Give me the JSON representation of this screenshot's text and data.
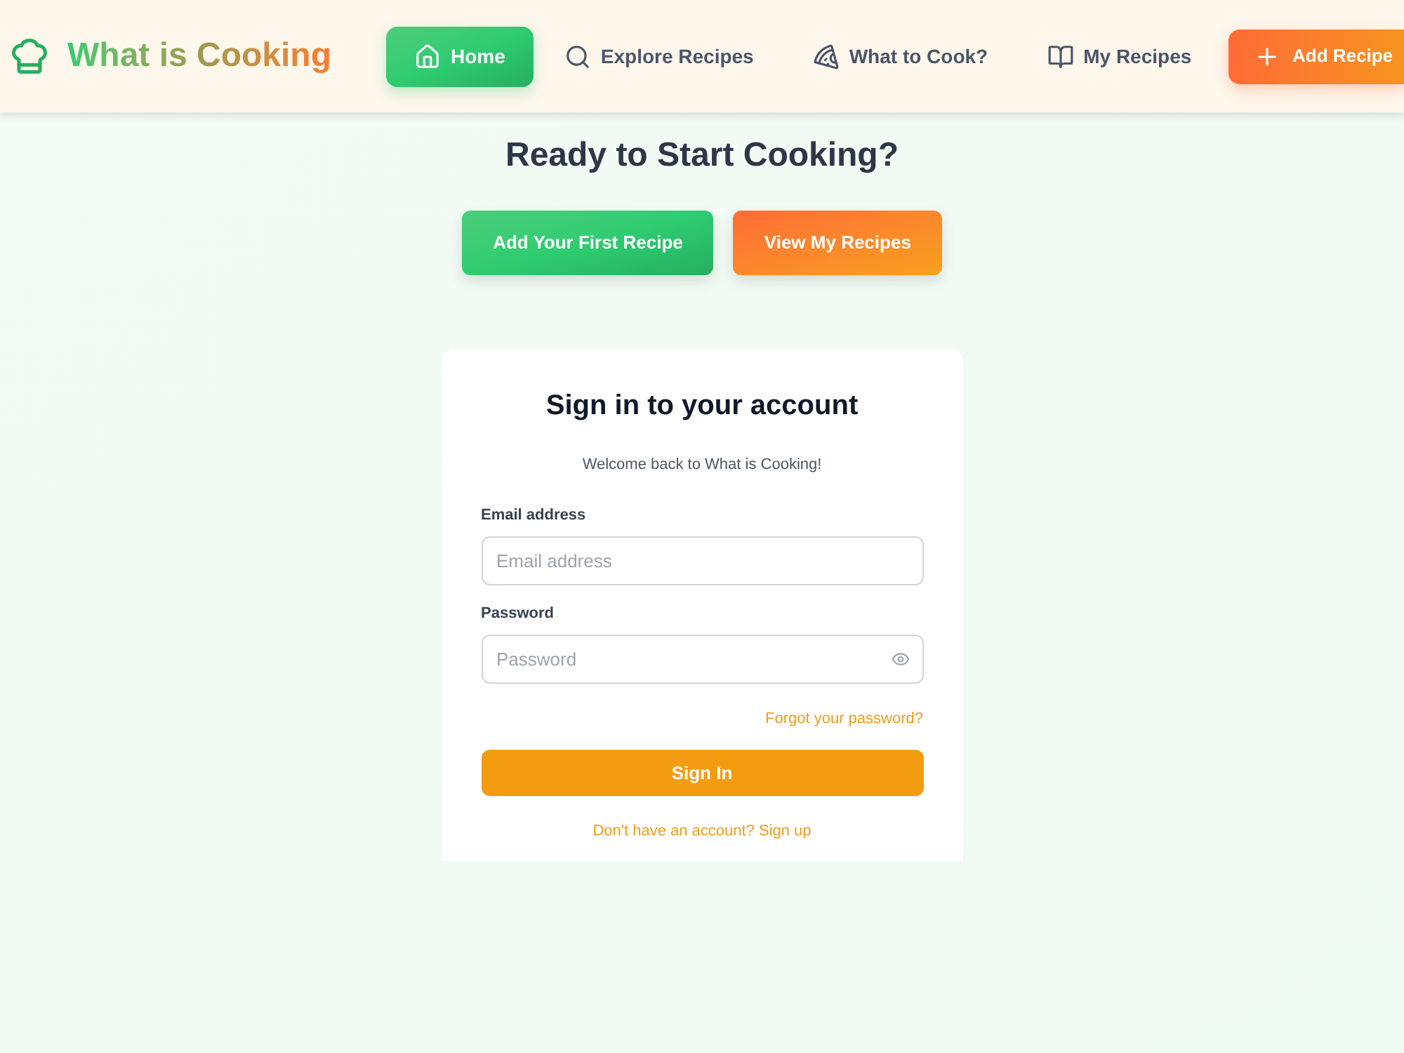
{
  "header": {
    "logo": {
      "text": "What is Cooking"
    },
    "nav": [
      {
        "label": "Home",
        "selected": true
      },
      {
        "label": "Explore Recipes",
        "selected": false
      },
      {
        "label": "What to Cook?",
        "selected": false
      },
      {
        "label": "My Recipes",
        "selected": false
      }
    ],
    "add_button": {
      "label": "Add Recipe"
    }
  },
  "hero": {
    "title": "Ready to Start Cooking?",
    "buttons": [
      {
        "label": "Add Your First Recipe",
        "kind": "primary"
      },
      {
        "label": "View My Recipes",
        "kind": "secondary"
      }
    ]
  },
  "signin": {
    "title": "Sign in to your account",
    "subtitle": "Welcome back to What is Cooking!",
    "fields": [
      {
        "label": "Email address",
        "placeholder": "Email address",
        "kind": "email"
      },
      {
        "label": "Password",
        "placeholder": "Password",
        "kind": "password"
      }
    ],
    "forgot_link": "Forgot your password?",
    "submit": "Sign In",
    "signup_link": "Don't have an account? Sign up"
  }
}
